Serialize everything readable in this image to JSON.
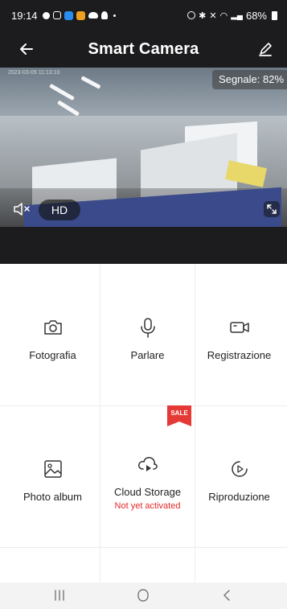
{
  "status_bar": {
    "time": "19:14",
    "battery": "68%"
  },
  "header": {
    "title": "Smart Camera"
  },
  "camera": {
    "timestamp": "2023-03-09 11:13:10",
    "signal_text": "Segnale: 82%",
    "hd_label": "HD"
  },
  "features": [
    {
      "label": "Fotografia",
      "icon": "camera-icon"
    },
    {
      "label": "Parlare",
      "icon": "microphone-icon"
    },
    {
      "label": "Registrazione",
      "icon": "video-camera-icon"
    },
    {
      "label": "Photo album",
      "icon": "image-icon"
    },
    {
      "label": "Cloud Storage",
      "icon": "cloud-play-icon",
      "sublabel": "Not yet activated",
      "badge": "SALE"
    },
    {
      "label": "Riproduzione",
      "icon": "playback-icon"
    }
  ],
  "colors": {
    "dark_bar": "#1c1c1e",
    "sale_red": "#e53935",
    "warning_text": "#e02a2a"
  }
}
